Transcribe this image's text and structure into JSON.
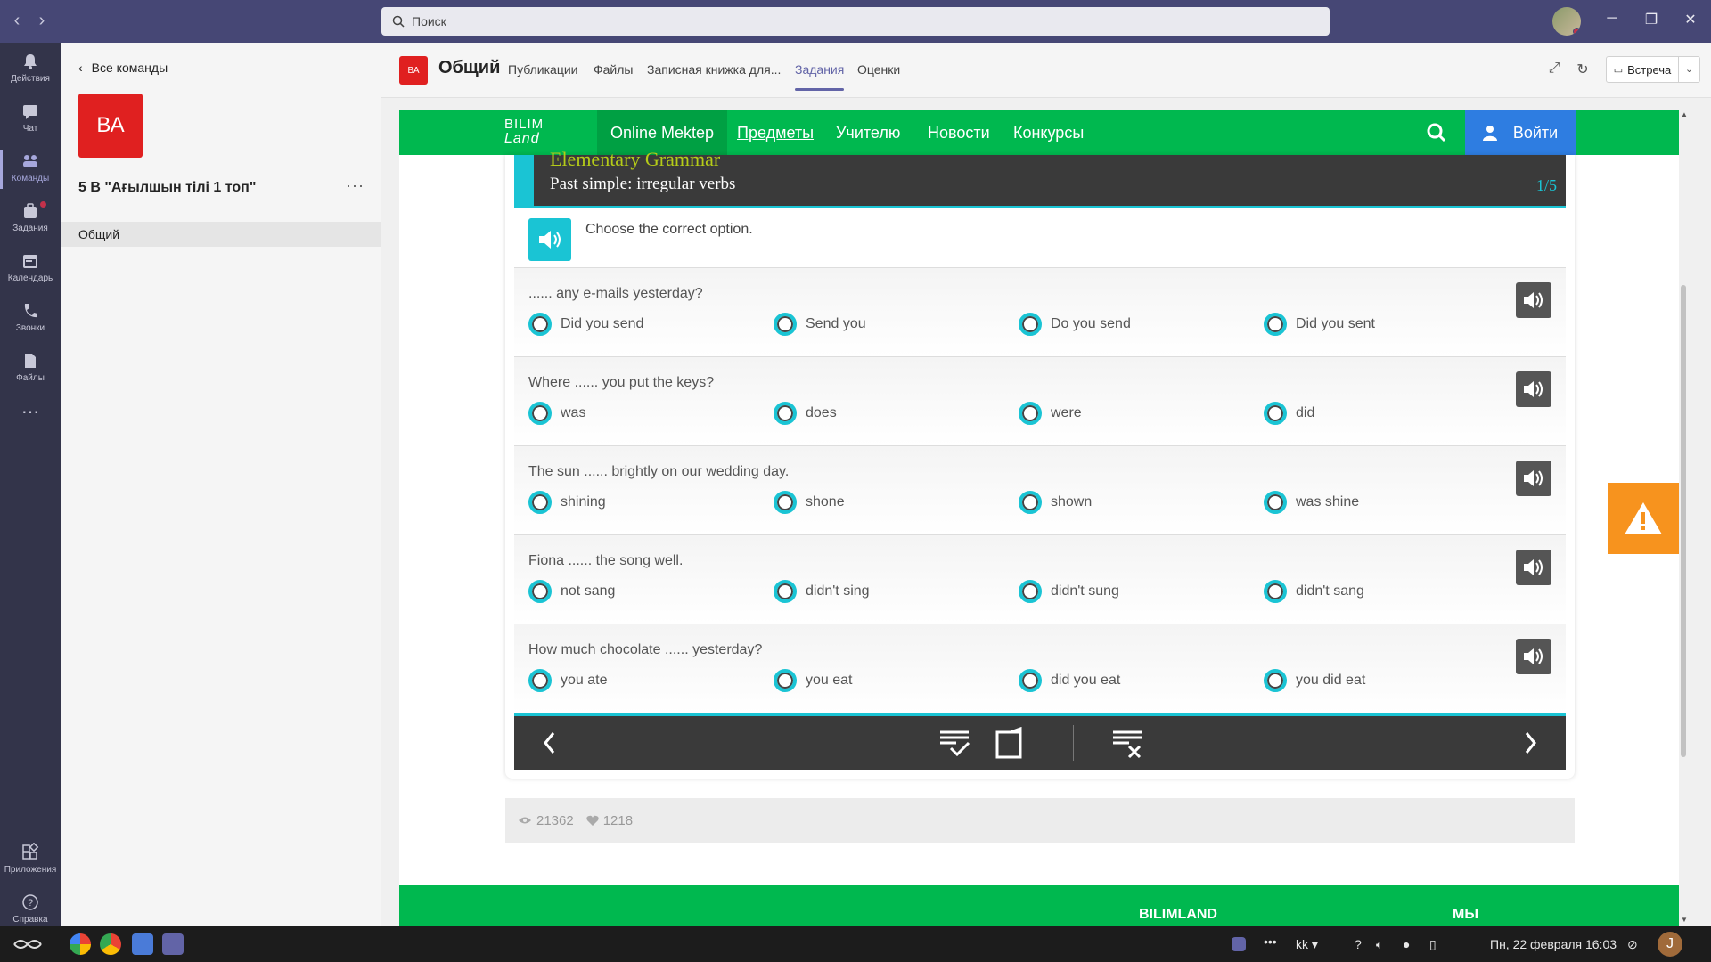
{
  "titlebar": {
    "search_placeholder": "Поиск"
  },
  "rail": {
    "items": [
      {
        "label": "Действия",
        "icon": "bell-icon"
      },
      {
        "label": "Чат",
        "icon": "chat-icon"
      },
      {
        "label": "Команды",
        "icon": "teams-icon"
      },
      {
        "label": "Задания",
        "icon": "assignments-icon"
      },
      {
        "label": "Календарь",
        "icon": "calendar-icon"
      },
      {
        "label": "Звонки",
        "icon": "phone-icon"
      },
      {
        "label": "Файлы",
        "icon": "files-icon"
      },
      {
        "label": "Приложения",
        "icon": "apps-icon"
      },
      {
        "label": "Справка",
        "icon": "help-icon"
      }
    ]
  },
  "team": {
    "back_label": "Все команды",
    "avatar_initials": "ВА",
    "name": "5 В \"Ағылшын тілі 1 топ\"",
    "channel": "Общий"
  },
  "channel_header": {
    "avatar_initials": "ВА",
    "title": "Общий",
    "tabs": [
      "Публикации",
      "Файлы",
      "Записная книжка для...",
      "Задания",
      "Оценки"
    ],
    "active_tab": "Задания",
    "meet_label": "Встреча"
  },
  "site": {
    "logo_line1": "BILIM",
    "logo_line2": "Land",
    "menu": [
      "Online Mektep",
      "Предметы",
      "Учителю",
      "Новости",
      "Конкурсы"
    ],
    "login_label": "Войти",
    "brand_color": "#00b84f"
  },
  "lesson": {
    "course": "Elementary Grammar",
    "title": "Past simple: irregular verbs",
    "page": "1/5",
    "instruction": "Choose the correct option.",
    "questions": [
      {
        "text": "...... any e-mails yesterday?",
        "options": [
          "Did you send",
          "Send you",
          "Do you send",
          "Did you sent"
        ]
      },
      {
        "text": "Where ...... you put the keys?",
        "options": [
          "was",
          "does",
          "were",
          "did"
        ]
      },
      {
        "text": "The sun ...... brightly on our wedding day.",
        "options": [
          "shining",
          "shone",
          "shown",
          "was shine"
        ]
      },
      {
        "text": "Fiona ...... the song well.",
        "options": [
          "not sang",
          "didn't sing",
          "didn't sung",
          "didn't sang"
        ]
      },
      {
        "text": "How much chocolate ...... yesterday?",
        "options": [
          "you ate",
          "you eat",
          "did you eat",
          "you did eat"
        ]
      }
    ]
  },
  "stats": {
    "views": "21362",
    "likes": "1218"
  },
  "footer": {
    "col1": "BILIMLAND",
    "col2": "МЫ"
  },
  "taskbar": {
    "lang": "kk",
    "datetime": "Пн, 22 февраля  16:03",
    "user_initial": "J"
  }
}
